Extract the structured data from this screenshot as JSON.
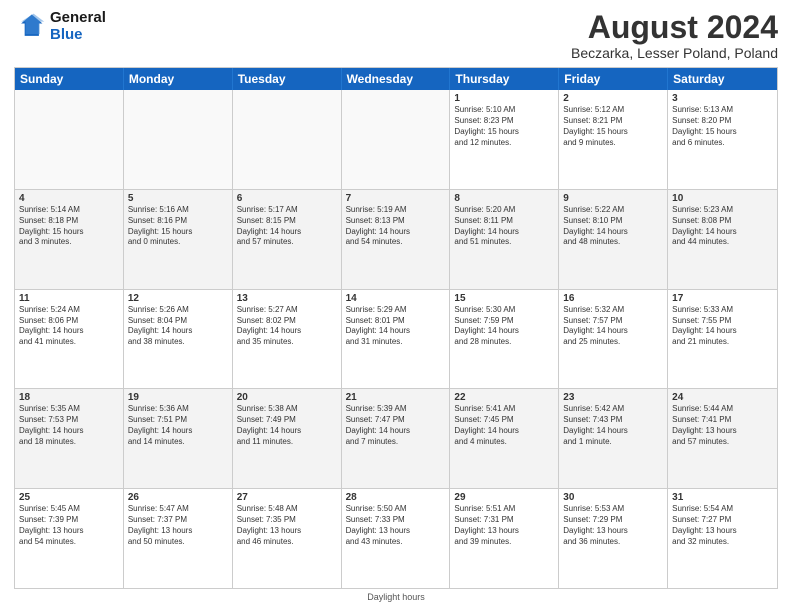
{
  "header": {
    "logo_line1": "General",
    "logo_line2": "Blue",
    "month_title": "August 2024",
    "subtitle": "Beczarka, Lesser Poland, Poland"
  },
  "days_of_week": [
    "Sunday",
    "Monday",
    "Tuesday",
    "Wednesday",
    "Thursday",
    "Friday",
    "Saturday"
  ],
  "footer": {
    "daylight_label": "Daylight hours"
  },
  "weeks": [
    [
      {
        "num": "",
        "info": ""
      },
      {
        "num": "",
        "info": ""
      },
      {
        "num": "",
        "info": ""
      },
      {
        "num": "",
        "info": ""
      },
      {
        "num": "1",
        "info": "Sunrise: 5:10 AM\nSunset: 8:23 PM\nDaylight: 15 hours\nand 12 minutes."
      },
      {
        "num": "2",
        "info": "Sunrise: 5:12 AM\nSunset: 8:21 PM\nDaylight: 15 hours\nand 9 minutes."
      },
      {
        "num": "3",
        "info": "Sunrise: 5:13 AM\nSunset: 8:20 PM\nDaylight: 15 hours\nand 6 minutes."
      }
    ],
    [
      {
        "num": "4",
        "info": "Sunrise: 5:14 AM\nSunset: 8:18 PM\nDaylight: 15 hours\nand 3 minutes."
      },
      {
        "num": "5",
        "info": "Sunrise: 5:16 AM\nSunset: 8:16 PM\nDaylight: 15 hours\nand 0 minutes."
      },
      {
        "num": "6",
        "info": "Sunrise: 5:17 AM\nSunset: 8:15 PM\nDaylight: 14 hours\nand 57 minutes."
      },
      {
        "num": "7",
        "info": "Sunrise: 5:19 AM\nSunset: 8:13 PM\nDaylight: 14 hours\nand 54 minutes."
      },
      {
        "num": "8",
        "info": "Sunrise: 5:20 AM\nSunset: 8:11 PM\nDaylight: 14 hours\nand 51 minutes."
      },
      {
        "num": "9",
        "info": "Sunrise: 5:22 AM\nSunset: 8:10 PM\nDaylight: 14 hours\nand 48 minutes."
      },
      {
        "num": "10",
        "info": "Sunrise: 5:23 AM\nSunset: 8:08 PM\nDaylight: 14 hours\nand 44 minutes."
      }
    ],
    [
      {
        "num": "11",
        "info": "Sunrise: 5:24 AM\nSunset: 8:06 PM\nDaylight: 14 hours\nand 41 minutes."
      },
      {
        "num": "12",
        "info": "Sunrise: 5:26 AM\nSunset: 8:04 PM\nDaylight: 14 hours\nand 38 minutes."
      },
      {
        "num": "13",
        "info": "Sunrise: 5:27 AM\nSunset: 8:02 PM\nDaylight: 14 hours\nand 35 minutes."
      },
      {
        "num": "14",
        "info": "Sunrise: 5:29 AM\nSunset: 8:01 PM\nDaylight: 14 hours\nand 31 minutes."
      },
      {
        "num": "15",
        "info": "Sunrise: 5:30 AM\nSunset: 7:59 PM\nDaylight: 14 hours\nand 28 minutes."
      },
      {
        "num": "16",
        "info": "Sunrise: 5:32 AM\nSunset: 7:57 PM\nDaylight: 14 hours\nand 25 minutes."
      },
      {
        "num": "17",
        "info": "Sunrise: 5:33 AM\nSunset: 7:55 PM\nDaylight: 14 hours\nand 21 minutes."
      }
    ],
    [
      {
        "num": "18",
        "info": "Sunrise: 5:35 AM\nSunset: 7:53 PM\nDaylight: 14 hours\nand 18 minutes."
      },
      {
        "num": "19",
        "info": "Sunrise: 5:36 AM\nSunset: 7:51 PM\nDaylight: 14 hours\nand 14 minutes."
      },
      {
        "num": "20",
        "info": "Sunrise: 5:38 AM\nSunset: 7:49 PM\nDaylight: 14 hours\nand 11 minutes."
      },
      {
        "num": "21",
        "info": "Sunrise: 5:39 AM\nSunset: 7:47 PM\nDaylight: 14 hours\nand 7 minutes."
      },
      {
        "num": "22",
        "info": "Sunrise: 5:41 AM\nSunset: 7:45 PM\nDaylight: 14 hours\nand 4 minutes."
      },
      {
        "num": "23",
        "info": "Sunrise: 5:42 AM\nSunset: 7:43 PM\nDaylight: 14 hours\nand 1 minute."
      },
      {
        "num": "24",
        "info": "Sunrise: 5:44 AM\nSunset: 7:41 PM\nDaylight: 13 hours\nand 57 minutes."
      }
    ],
    [
      {
        "num": "25",
        "info": "Sunrise: 5:45 AM\nSunset: 7:39 PM\nDaylight: 13 hours\nand 54 minutes."
      },
      {
        "num": "26",
        "info": "Sunrise: 5:47 AM\nSunset: 7:37 PM\nDaylight: 13 hours\nand 50 minutes."
      },
      {
        "num": "27",
        "info": "Sunrise: 5:48 AM\nSunset: 7:35 PM\nDaylight: 13 hours\nand 46 minutes."
      },
      {
        "num": "28",
        "info": "Sunrise: 5:50 AM\nSunset: 7:33 PM\nDaylight: 13 hours\nand 43 minutes."
      },
      {
        "num": "29",
        "info": "Sunrise: 5:51 AM\nSunset: 7:31 PM\nDaylight: 13 hours\nand 39 minutes."
      },
      {
        "num": "30",
        "info": "Sunrise: 5:53 AM\nSunset: 7:29 PM\nDaylight: 13 hours\nand 36 minutes."
      },
      {
        "num": "31",
        "info": "Sunrise: 5:54 AM\nSunset: 7:27 PM\nDaylight: 13 hours\nand 32 minutes."
      }
    ]
  ]
}
